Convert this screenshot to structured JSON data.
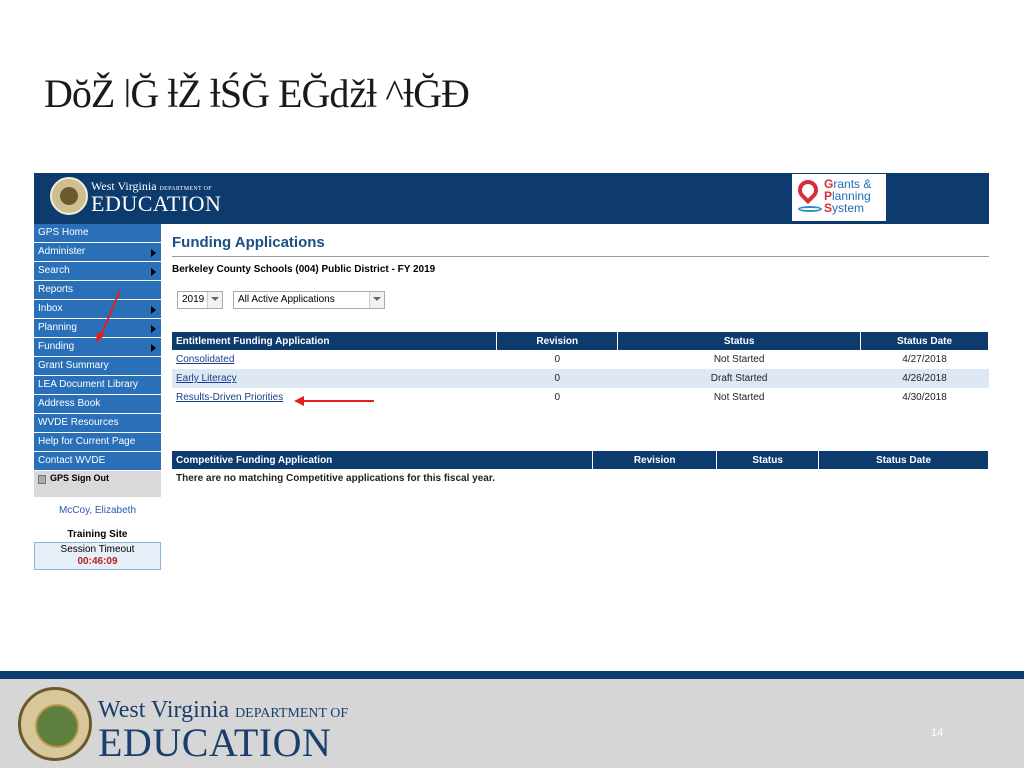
{
  "slide": {
    "title": "DŏŽ ǀĞ ƚŽ ƚŚĞ EĞǆƚ ^ƚĞƉ",
    "page_number": "14"
  },
  "header": {
    "logo_line1": "West Virginia",
    "logo_line1_small": "DEPARTMENT OF",
    "logo_line2": "EDUCATION",
    "gps_logo": {
      "line1_cap": "G",
      "line1": "rants &",
      "line2_cap": "P",
      "line2": "lanning",
      "line3_cap": "S",
      "line3": "ystem"
    }
  },
  "sidebar": {
    "items": [
      {
        "label": "GPS Home",
        "has_submenu": false
      },
      {
        "label": "Administer",
        "has_submenu": true
      },
      {
        "label": "Search",
        "has_submenu": true
      },
      {
        "label": "Reports",
        "has_submenu": false
      },
      {
        "label": "Inbox",
        "has_submenu": true
      },
      {
        "label": "Planning",
        "has_submenu": true
      },
      {
        "label": "Funding",
        "has_submenu": true
      },
      {
        "label": "Grant Summary",
        "has_submenu": false
      },
      {
        "label": "LEA Document Library",
        "has_submenu": false
      },
      {
        "label": "Address Book",
        "has_submenu": false
      },
      {
        "label": "WVDE Resources",
        "has_submenu": false
      },
      {
        "label": "Help for Current Page",
        "has_submenu": false
      },
      {
        "label": "Contact WVDE",
        "has_submenu": false
      }
    ],
    "sign_out": "GPS Sign Out",
    "user_name": "McCoy, Elizabeth",
    "site_label": "Training Site",
    "session_label": "Session Timeout",
    "session_time": "00:46:09"
  },
  "main": {
    "title": "Funding Applications",
    "district": "Berkeley County Schools (004) Public District - FY 2019",
    "year_select": "2019",
    "filter_select": "All Active Applications",
    "entitlement_table": {
      "headers": [
        "Entitlement Funding Application",
        "Revision",
        "Status",
        "Status Date"
      ],
      "rows": [
        {
          "name": "Consolidated",
          "revision": "0",
          "status": "Not Started",
          "date": "4/27/2018"
        },
        {
          "name": "Early Literacy",
          "revision": "0",
          "status": "Draft Started",
          "date": "4/26/2018"
        },
        {
          "name": "Results-Driven Priorities",
          "revision": "0",
          "status": "Not Started",
          "date": "4/30/2018"
        }
      ]
    },
    "competitive_table": {
      "headers": [
        "Competitive Funding Application",
        "Revision",
        "Status",
        "Status Date"
      ],
      "empty_message": "There are no matching Competitive applications for this fiscal year."
    }
  },
  "footer": {
    "logo_line1": "West Virginia",
    "logo_line1_small": "DEPARTMENT OF",
    "logo_line2": "EDUCATION"
  },
  "colors": {
    "navy": "#0d3b6e",
    "nav_blue": "#2a70b8",
    "row_alt": "#dde8f4",
    "arrow_red": "#e02020"
  }
}
